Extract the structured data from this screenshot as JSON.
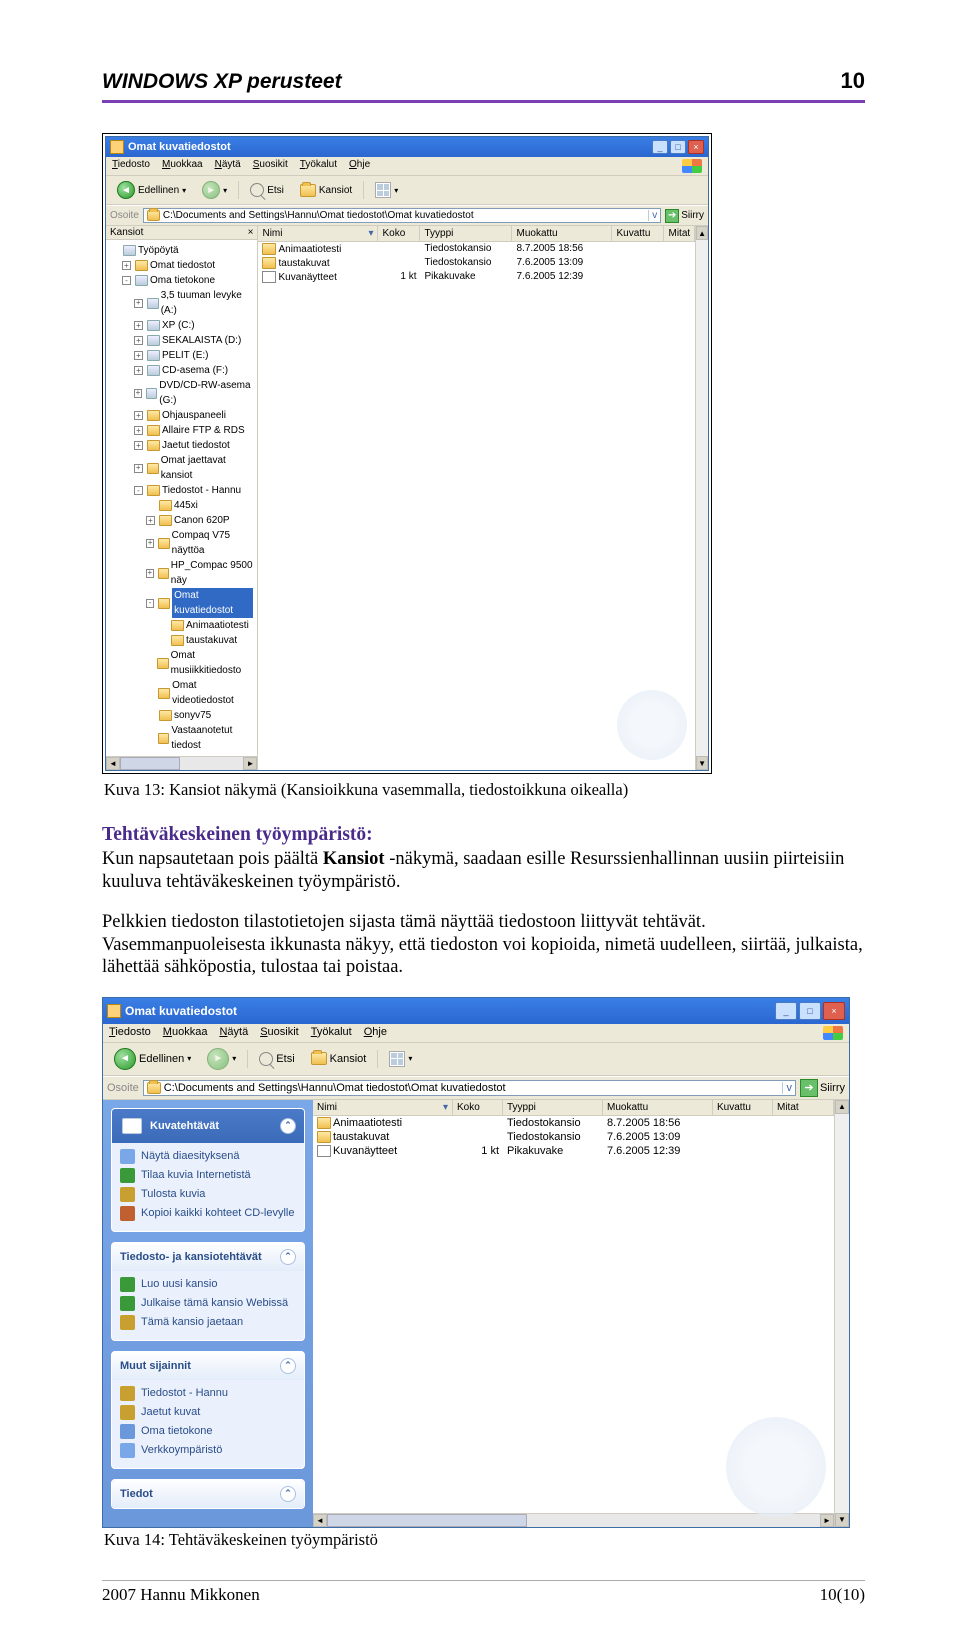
{
  "header": {
    "title": "WINDOWS XP  perusteet",
    "page_top": "10"
  },
  "fig1": {
    "caption": "Kuva 13: Kansiot näkymä (Kansioikkuna vasemmalla, tiedostoikkuna oikealla)",
    "window_title": "Omat kuvatiedostot",
    "menu": [
      "Tiedosto",
      "Muokkaa",
      "Näytä",
      "Suosikit",
      "Työkalut",
      "Ohje"
    ],
    "toolbar": {
      "back": "Edellinen",
      "search": "Etsi",
      "folders": "Kansiot"
    },
    "address": {
      "label": "Osoite",
      "path": "C:\\Documents and Settings\\Hannu\\Omat tiedostot\\Omat kuvatiedostot",
      "go": "Siirry"
    },
    "left_title": "Kansiot",
    "cols": [
      "Nimi",
      "Koko",
      "Tyyppi",
      "Muokattu",
      "Kuvattu",
      "Mitat"
    ],
    "tree": [
      {
        "lvl": 0,
        "pm": "",
        "ico": "d",
        "label": "Työpöytä"
      },
      {
        "lvl": 1,
        "pm": "+",
        "ico": "f",
        "label": "Omat tiedostot"
      },
      {
        "lvl": 1,
        "pm": "-",
        "ico": "d",
        "label": "Oma tietokone"
      },
      {
        "lvl": 2,
        "pm": "+",
        "ico": "d",
        "label": "3,5 tuuman levyke (A:)"
      },
      {
        "lvl": 2,
        "pm": "+",
        "ico": "d",
        "label": "XP (C:)"
      },
      {
        "lvl": 2,
        "pm": "+",
        "ico": "d",
        "label": "SEKALAISTA (D:)"
      },
      {
        "lvl": 2,
        "pm": "+",
        "ico": "d",
        "label": "PELIT (E:)"
      },
      {
        "lvl": 2,
        "pm": "+",
        "ico": "d",
        "label": "CD-asema (F:)"
      },
      {
        "lvl": 2,
        "pm": "+",
        "ico": "d",
        "label": "DVD/CD-RW-asema (G:)"
      },
      {
        "lvl": 2,
        "pm": "+",
        "ico": "f",
        "label": "Ohjauspaneeli"
      },
      {
        "lvl": 2,
        "pm": "+",
        "ico": "f",
        "label": "Allaire FTP & RDS"
      },
      {
        "lvl": 2,
        "pm": "+",
        "ico": "f",
        "label": "Jaetut tiedostot"
      },
      {
        "lvl": 2,
        "pm": "+",
        "ico": "f",
        "label": "Omat jaettavat kansiot"
      },
      {
        "lvl": 2,
        "pm": "-",
        "ico": "f",
        "label": "Tiedostot - Hannu"
      },
      {
        "lvl": 3,
        "pm": "",
        "ico": "f",
        "label": "445xi"
      },
      {
        "lvl": 3,
        "pm": "+",
        "ico": "f",
        "label": "Canon 620P"
      },
      {
        "lvl": 3,
        "pm": "+",
        "ico": "f",
        "label": "Compaq V75 näyttöa"
      },
      {
        "lvl": 3,
        "pm": "+",
        "ico": "f",
        "label": "HP_Compac 9500 näy"
      },
      {
        "lvl": 3,
        "pm": "-",
        "ico": "f",
        "label": "Omat kuvatiedostot",
        "sel": true
      },
      {
        "lvl": 4,
        "pm": "",
        "ico": "f",
        "label": "Animaatiotesti"
      },
      {
        "lvl": 4,
        "pm": "",
        "ico": "f",
        "label": "taustakuvat"
      },
      {
        "lvl": 3,
        "pm": "",
        "ico": "f",
        "label": "Omat musiikkitiedosto"
      },
      {
        "lvl": 3,
        "pm": "",
        "ico": "f",
        "label": "Omat videotiedostot"
      },
      {
        "lvl": 3,
        "pm": "",
        "ico": "f",
        "label": "sonyv75"
      },
      {
        "lvl": 3,
        "pm": "",
        "ico": "f",
        "label": "Vastaanotetut tiedost"
      }
    ],
    "rows": [
      {
        "name": "Animaatiotesti",
        "size": "",
        "type": "Tiedostokansio",
        "mod": "8.7.2005 18:56",
        "ico": "f"
      },
      {
        "name": "taustakuvat",
        "size": "",
        "type": "Tiedostokansio",
        "mod": "7.6.2005 13:09",
        "ico": "f"
      },
      {
        "name": "Kuvanäytteet",
        "size": "1 kt",
        "type": "Pikakuvake",
        "mod": "7.6.2005 12:39",
        "ico": "file"
      }
    ]
  },
  "body": {
    "h1": "Tehtäväkeskeinen työympäristö:",
    "p1a": "Kun napsautetaan pois päältä ",
    "p1b": "Kansiot",
    "p1c": " -näkymä, saadaan esille Resurssienhallinnan uusiin piirteisiin kuuluva tehtäväkeskeinen työympäristö.",
    "p2": "Pelkkien tiedoston tilastotietojen sijasta tämä näyttää tiedostoon liittyvät tehtävät. Vasemmanpuoleisesta ikkunasta näkyy, että tiedoston voi kopioida, nimetä uudelleen, siirtää, julkaista, lähettää sähköpostia, tulostaa tai poistaa."
  },
  "fig2": {
    "caption": "Kuva 14: Tehtäväkeskeinen työympäristö",
    "window_title": "Omat kuvatiedostot",
    "menu": [
      "Tiedosto",
      "Muokkaa",
      "Näytä",
      "Suosikit",
      "Työkalut",
      "Ohje"
    ],
    "toolbar": {
      "back": "Edellinen",
      "search": "Etsi",
      "folders": "Kansiot"
    },
    "address": {
      "label": "Osoite",
      "path": "C:\\Documents and Settings\\Hannu\\Omat tiedostot\\Omat kuvatiedostot",
      "go": "Siirry"
    },
    "cols": [
      "Nimi",
      "Koko",
      "Tyyppi",
      "Muokattu",
      "Kuvattu",
      "Mitat"
    ],
    "rows": [
      {
        "name": "Animaatiotesti",
        "size": "",
        "type": "Tiedostokansio",
        "mod": "8.7.2005 18:56",
        "ico": "f"
      },
      {
        "name": "taustakuvat",
        "size": "",
        "type": "Tiedostokansio",
        "mod": "7.6.2005 13:09",
        "ico": "f"
      },
      {
        "name": "Kuvanäytteet",
        "size": "1 kt",
        "type": "Pikakuvake",
        "mod": "7.6.2005 12:39",
        "ico": "file"
      }
    ],
    "groups": [
      {
        "title": "Kuvatehtävät",
        "style": "dark",
        "items": [
          "Näytä diaesityksenä",
          "Tilaa kuvia Internetistä",
          "Tulosta kuvia",
          "Kopioi kaikki kohteet CD-levylle"
        ]
      },
      {
        "title": "Tiedosto- ja kansiotehtävät",
        "style": "light",
        "items": [
          "Luo uusi kansio",
          "Julkaise tämä kansio Webissä",
          "Tämä kansio jaetaan"
        ]
      },
      {
        "title": "Muut sijainnit",
        "style": "light",
        "items": [
          "Tiedostot - Hannu",
          "Jaetut kuvat",
          "Oma tietokone",
          "Verkkoympäristö"
        ]
      },
      {
        "title": "Tiedot",
        "style": "light",
        "items": []
      }
    ]
  },
  "footer": {
    "left": "2007 Hannu Mikkonen",
    "right": "10(10)"
  }
}
